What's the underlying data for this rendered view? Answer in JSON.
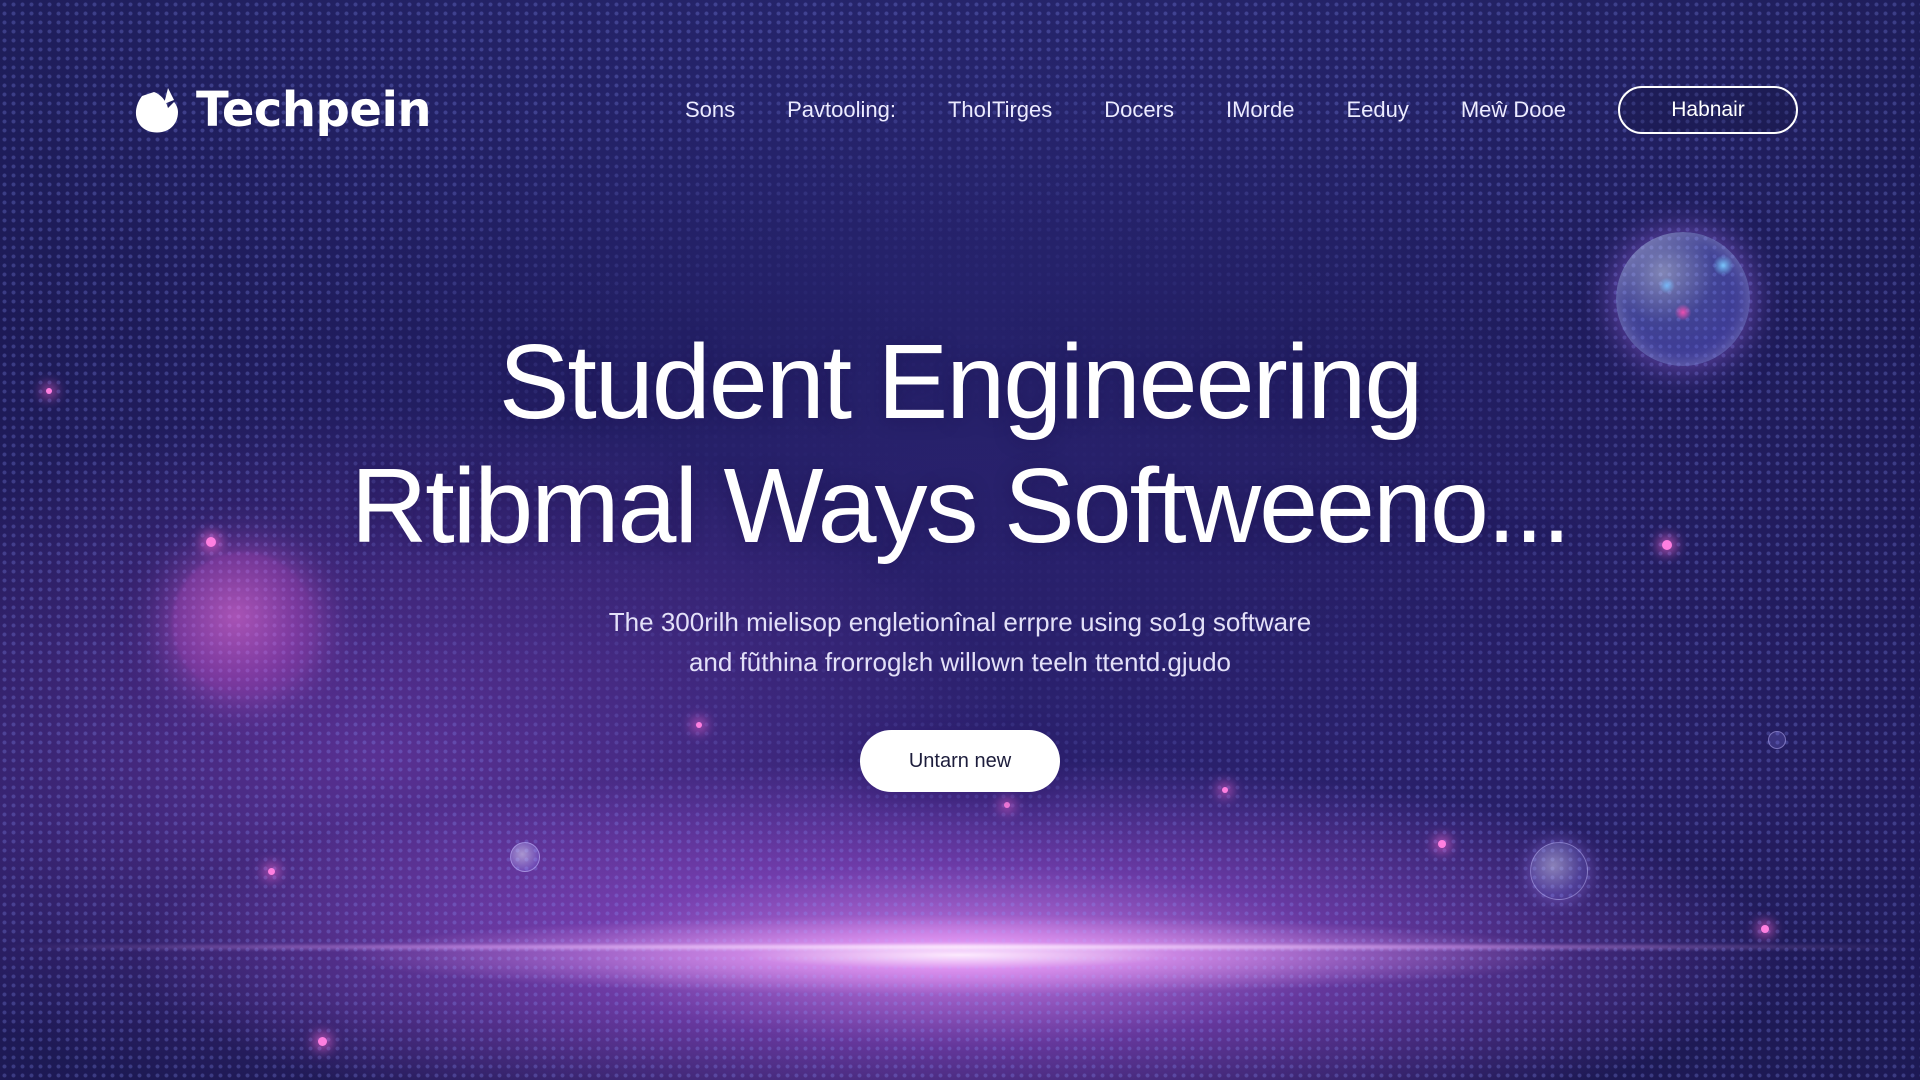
{
  "brand": {
    "name": "Techpein",
    "logo_icon": "leaf-shield-icon"
  },
  "nav": {
    "items": [
      {
        "label": "Sons"
      },
      {
        "label": "Pavtooling:"
      },
      {
        "label": "ThoITirges"
      },
      {
        "label": "Docers"
      },
      {
        "label": "IMorde"
      },
      {
        "label": "Eeduy"
      },
      {
        "label": "Meŵ Dooe"
      }
    ],
    "cta_label": "Habnair"
  },
  "hero": {
    "title_line1": "Student Engineering",
    "title_line2": "Rtibmal Ways Softweeno...",
    "subtitle_line1": "The 300rilh mielisop engletionînal errpre using so1g software",
    "subtitle_line2": "and fũthina frorroglεh willown teeln ttentd.gjudo",
    "button_label": "Untarn new"
  },
  "colors": {
    "background_top": "#2c2a7a",
    "background_bottom": "#2a2270",
    "glow": "#e88cff",
    "button_bg": "#ffffff",
    "button_text": "#1d1d3c"
  }
}
